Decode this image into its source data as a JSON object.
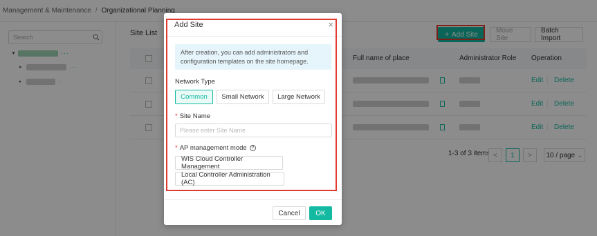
{
  "breadcrumb": {
    "parent": "Management & Maintenance",
    "separator": "/",
    "current": "Organizational Planning"
  },
  "tree": {
    "search_placeholder": "Search",
    "more": "···"
  },
  "main": {
    "title": "Site List",
    "buttons": {
      "add": "Add Site",
      "move": "Move Site",
      "batch": "Batch Import"
    },
    "columns": {
      "full_name": "Full name of place",
      "admin_role": "Administrator Role",
      "operation": "Operation"
    },
    "row_actions": {
      "edit": "Edit",
      "delete": "Delete"
    },
    "pagination": {
      "summary": "1-3 of 3 items",
      "prev": "<",
      "page": "1",
      "next": ">",
      "page_size": "10 / page"
    }
  },
  "modal": {
    "title": "Add Site",
    "close": "×",
    "info": "After creation, you can add administrators and configuration templates on the site homepage.",
    "network_type": {
      "label": "Network Type",
      "options": [
        "Common",
        "Small Network",
        "Large Network"
      ],
      "selected": "Common"
    },
    "site_name": {
      "label": "Site Name",
      "required_mark": "*",
      "placeholder": "Please enter Site Name",
      "value": ""
    },
    "ap_mode": {
      "label": "AP management mode",
      "required_mark": "*",
      "help": "?",
      "options": [
        "WIS Cloud Controller Management",
        "Local Controller Administration (AC)"
      ]
    },
    "cancel": "Cancel",
    "ok": "OK"
  },
  "colors": {
    "accent": "#13b9a0",
    "highlight": "#e03a2e",
    "info_bg": "#e6f5fb"
  }
}
